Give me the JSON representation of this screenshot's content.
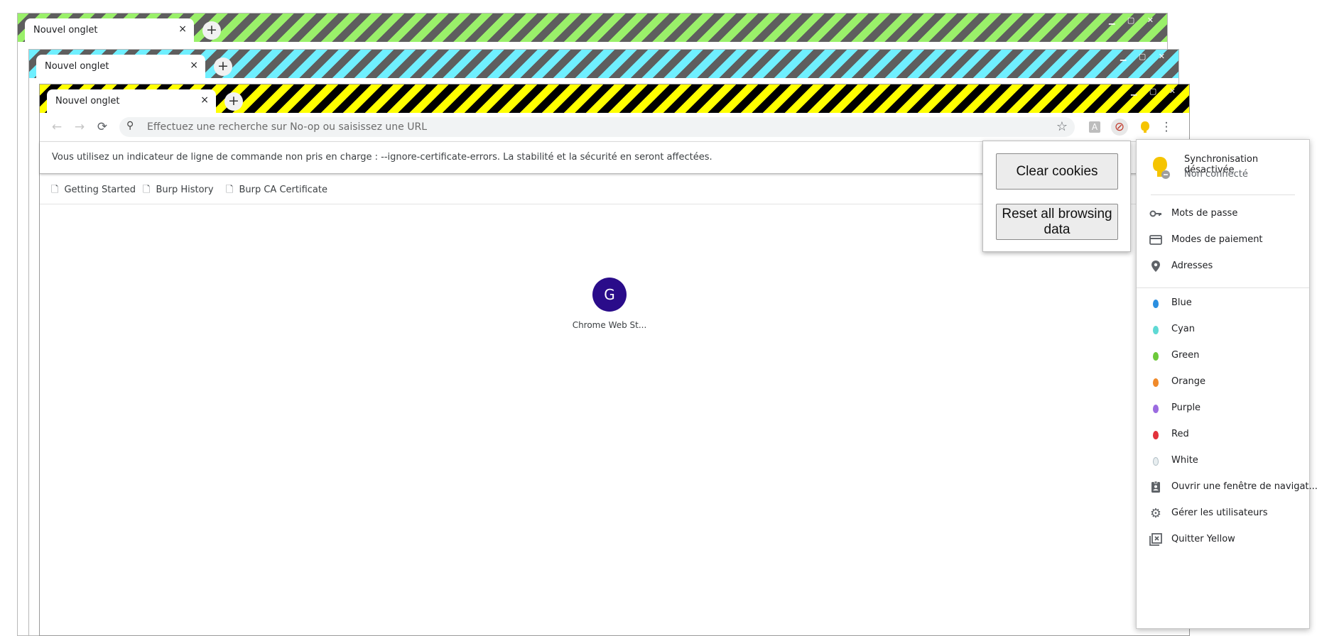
{
  "windows": [
    {
      "tab_title": "Nouvel onglet",
      "theme": "#9af06a"
    },
    {
      "tab_title": "Nouvel onglet",
      "theme": "#6fefff"
    },
    {
      "tab_title": "Nouvel onglet",
      "theme": "#ffff00"
    }
  ],
  "tab": {
    "close_glyph": "×",
    "new_tab_glyph": "+"
  },
  "window_controls": "▁ ▢ ✕",
  "toolbar": {
    "back_icon": "←",
    "forward_icon": "→",
    "reload_icon": "⟳",
    "omnibox_placeholder": "Effectuez une recherche sur No-op ou saisissez une URL",
    "search_icon": "⚲",
    "star_icon": "☆",
    "translate_icon": "A",
    "block_icon": "⊘",
    "menu_icon": "⋮"
  },
  "infobar": {
    "message": "Vous utilisez un indicateur de ligne de commande non pris en charge : --ignore-certificate-errors. La stabilité et la sécurité en seront affectées."
  },
  "bookmarks": [
    {
      "label": "Getting Started"
    },
    {
      "label": "Burp History"
    },
    {
      "label": "Burp CA Certificate"
    }
  ],
  "new_tab_page": {
    "shortcut": {
      "letter": "G",
      "label": "Chrome Web St..."
    }
  },
  "extension_popup": {
    "clear_cookies": "Clear cookies",
    "reset_all": "Reset all browsing data"
  },
  "profile_menu": {
    "sync_status": "Synchronisation désactivée",
    "account_status": "Non connecté",
    "autofill": [
      {
        "label": "Mots de passe",
        "icon": "key-icon"
      },
      {
        "label": "Modes de paiement",
        "icon": "credit-card-icon"
      },
      {
        "label": "Adresses",
        "icon": "location-pin-icon"
      }
    ],
    "profiles": [
      {
        "label": "Blue",
        "color": "#2b8fe0"
      },
      {
        "label": "Cyan",
        "color": "#5fd9d4"
      },
      {
        "label": "Green",
        "color": "#6cc93a"
      },
      {
        "label": "Orange",
        "color": "#f08a2a"
      },
      {
        "label": "Purple",
        "color": "#9b6be0"
      },
      {
        "label": "Red",
        "color": "#e2323b"
      },
      {
        "label": "White",
        "color": "#e8eef0"
      }
    ],
    "actions": [
      {
        "label": "Ouvrir une fenêtre de navigat...",
        "icon": "guest-badge-icon"
      },
      {
        "label": "Gérer les utilisateurs",
        "icon": "gear-icon"
      },
      {
        "label": "Quitter Yellow",
        "icon": "exit-profile-icon"
      }
    ],
    "current_profile_color": "#f5c400"
  }
}
